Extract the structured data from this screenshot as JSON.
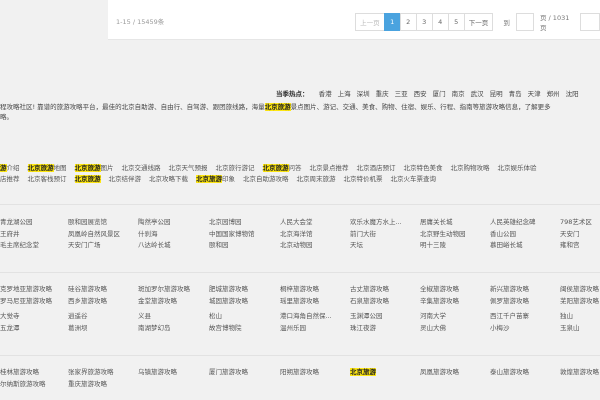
{
  "pagination": {
    "count_text": "1-15 / 15459条",
    "prev": "上一页",
    "pages": [
      "1",
      "2",
      "3",
      "4",
      "5"
    ],
    "active": "1",
    "next": "下一页",
    "goto": "到",
    "total": "页 / 1031页"
  },
  "hot": {
    "label": "当季热点：",
    "cities": [
      "香港",
      "上海",
      "深圳",
      "重庆",
      "三亚",
      "西安",
      "厦门",
      "南京",
      "武汉",
      "昆明",
      "青岛",
      "天津",
      "郑州",
      "沈阳"
    ]
  },
  "intro": {
    "line1a": "程攻略社区! 靠谱的旅游攻略平台，最佳的北京自助游、自由行、自驾游、跟团旅线路，海量",
    "line1hl": "北京旅游",
    "line1b": "景点图片、游记、交通、美食、购物、住宿、娱乐、行程、指南等旅游攻略信息，了解更多",
    "line2": "略。"
  },
  "links_row1": [
    {
      "hl": "游",
      "t": "介绍"
    },
    {
      "hl": "北京旅游",
      "t": "地图"
    },
    {
      "hl": "北京旅游",
      "t": "图片"
    },
    {
      "hl": "",
      "t": "北京交通线路"
    },
    {
      "hl": "",
      "t": "北京天气预报"
    },
    {
      "hl": "",
      "t": "北京旅行游记"
    },
    {
      "hl": "北京旅游",
      "t": "问答"
    },
    {
      "hl": "",
      "t": "北京景点推荐"
    },
    {
      "hl": "",
      "t": "北京酒店预订"
    },
    {
      "hl": "",
      "t": "北京特色美食"
    },
    {
      "hl": "",
      "t": "北京购物攻略"
    },
    {
      "hl": "",
      "t": "北京娱乐体验"
    }
  ],
  "links_row2": [
    {
      "hl": "",
      "t": "店推荐"
    },
    {
      "hl": "",
      "t": "北京客栈预订"
    },
    {
      "hl": "北京旅游",
      "t": ""
    },
    {
      "hl": "",
      "t": "北京结伴游"
    },
    {
      "hl": "",
      "t": "北京攻略下载"
    },
    {
      "hl": "北京旅游",
      "t": "印象"
    },
    {
      "hl": "",
      "t": "北京自助游攻略"
    },
    {
      "hl": "",
      "t": "北京周末旅游"
    },
    {
      "hl": "",
      "t": "北京特价机票"
    },
    {
      "hl": "",
      "t": "北京火车票查询"
    }
  ],
  "attractions": [
    [
      "青龙湖公园",
      "颐和园展览馆",
      "陶然亭公园",
      "北京园博园",
      "人民大会堂",
      "欢乐水魔方水上...",
      "居庸关长城",
      "人民英雄纪念碑",
      "798艺术区"
    ],
    [
      "王府井",
      "凤凰岭自然风景区",
      "什刹海",
      "中国国家博物馆",
      "北京海洋馆",
      "前门大街",
      "北京野生动物园",
      "香山公园",
      "天安门"
    ],
    [
      "毛主席纪念堂",
      "天安门广场",
      "八达岭长城",
      "颐和园",
      "北京动物园",
      "天坛",
      "明十三陵",
      "慕田峪长城",
      "雍和宫"
    ]
  ],
  "guides": [
    [
      "克罗地亚旅游攻略",
      "硅谷旅游攻略",
      "斑加罗尔旅游攻略",
      "肥城旅游攻略",
      "桐梓旅游攻略",
      "古丈旅游攻略",
      "全椒旅游攻略",
      "新兴旅游攻略",
      "闽侯旅游攻略"
    ],
    [
      "罗马尼亚旅游攻略",
      "西乡旅游攻略",
      "金堂旅游攻略",
      "城固旅游攻略",
      "瑶里旅游攻略",
      "石泉旅游攻略",
      "辛集旅游攻略",
      "佩罗旅游攻略",
      "芜阳旅游攻略"
    ]
  ],
  "spots": [
    [
      "大觉寺",
      "逍遥谷",
      "义县",
      "松山",
      "港口海角自然保...",
      "玉渊潭公园",
      "河南大学",
      "西江千户苗寨",
      "独山"
    ],
    [
      "五龙潭",
      "葛洲坝",
      "南湖梦幻岛",
      "故宫博物院",
      "温州乐园",
      "珠江夜游",
      "灵山大佛",
      "小梅沙",
      "玉泉山"
    ]
  ],
  "bottom": [
    [
      {
        "hl": "",
        "t": "桂林旅游攻略"
      },
      {
        "hl": "",
        "t": "张家界旅游攻略"
      },
      {
        "hl": "",
        "t": "乌镇旅游攻略"
      },
      {
        "hl": "",
        "t": "厦门旅游攻略"
      },
      {
        "hl": "",
        "t": "阳朔旅游攻略"
      },
      {
        "hl": "北京旅游",
        "t": ""
      },
      {
        "hl": "",
        "t": "凤凰旅游攻略"
      },
      {
        "hl": "",
        "t": "泰山旅游攻略"
      },
      {
        "hl": "",
        "t": "敦煌旅游攻略"
      }
    ],
    [
      {
        "hl": "",
        "t": "尔纳斯旅游攻略"
      },
      {
        "hl": "",
        "t": "重庆旅游攻略"
      }
    ]
  ]
}
